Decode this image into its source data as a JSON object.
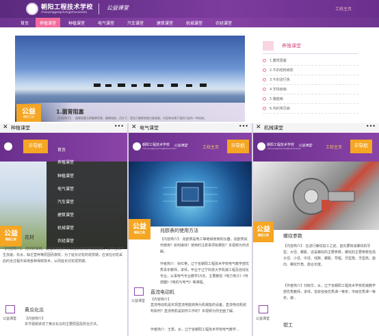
{
  "desktop": {
    "school_name": "朝阳工程技术学校",
    "school_name_en": "chaoyanggongchengjishuxuexiao",
    "charity_label": "公益课堂",
    "main_site": "工校主页",
    "nav": [
      "首页",
      "养殖课堂",
      "种植课堂",
      "电气课堂",
      "汽车课堂",
      "建筑课堂",
      "机械课堂",
      "农经课堂"
    ],
    "banner_caption": "1.菌胃阻塞",
    "banner_badge": "公益",
    "banner_badge_sub": "朝阳工校",
    "banner_text": "【内容简介】：菌胃阻塞又称瓣胃积食、瓣胃秘结、百叶干，是由于瓣胃收缩力量减弱，内容物充满干涸而引起的一种疾病。",
    "sidebar_title": "养殖课堂",
    "sidebar_items": [
      "1.菌胃阻塞",
      "2.牛的结核病防",
      "3.牛的流行热",
      "4.羊快疫病",
      "5.猪瘟病",
      "6.鸡的常见病"
    ]
  },
  "phone1": {
    "title": "种植课堂",
    "more": "•••",
    "nav_button": "导航",
    "menu": [
      "首页",
      "养殖课堂",
      "种植课堂",
      "电气课堂",
      "汽车课堂",
      "建筑课堂",
      "机械课堂",
      "农经课堂"
    ],
    "badge": "公益",
    "badge_sub": "朝阳工校",
    "heading": "花材",
    "text": "【内容简介】：花材的保鲜，是指采用各种方法延长切花的观赏期限，由于乙烯产生加速，失水，缺乏营养等原因而衰败，为了延长切花的观赏期，应该在切花采后的全过程中采用各种保鲜技术，从而延长切花观赏期。",
    "icon_label": "公益课堂",
    "item_title": "黄瓜化瓜",
    "item_tag": "【内容简介】",
    "item_text": "本节视频讲述了黄瓜化瓜的主要原因及防治方法。"
  },
  "phone2": {
    "title": "电气课堂",
    "more": "•••",
    "school_name": "朝阳工程技术学校",
    "school_name_en": "chaoyanggongchengjishuxuexiao",
    "charity_label": "公益课堂",
    "main_site": "工校主页",
    "nav_button": "导航",
    "badge": "公益",
    "badge_sub": "朝阳工校",
    "heading": "兆欧表的使用方法",
    "text1": "【内容简介】：兆欧表是电工等绝缘使用的仪器，兆欧表如何使用？如何接线？使用时注意事项有哪些？本视频为你详解。",
    "text2": "作者简介：张红艳，辽宁省朝阳工程技术学校电气教学部优秀青年教师，讲师，毕业于辽宁科技大学机械工程及自动化专业，从事电气专业教学15年。主要教授《电力电子》《传感器》《电机与电气》等课程。",
    "icon_label": "公益课堂",
    "item_title": "直流电动机",
    "item_tag": "【内容简介】",
    "item_text": "直流电动机是实现直流电能转换为机械能的设备，直流电动机结构如何？直流电机是如何工作的？本视频为你全面了解。",
    "item_author": "作者简介：王惠，女，辽宁省朝阳工程技术学校电气教学..."
  },
  "phone3": {
    "title": "机械课堂",
    "more": "•••",
    "school_name": "朝阳工程技术学校",
    "school_name_en": "chaoyanggongchengjishuxuexiao",
    "charity_label": "公益课堂",
    "main_site": "工校主页",
    "nav_button": "导航",
    "badge": "公益",
    "badge_sub": "朝阳工校",
    "heading": "螺纹参数",
    "text": "【内容简介】：在进行螺纹加工之前，首先要知道螺纹的牙型、大径、螺距、这是螺纹的主要参数，螺纹的主要参数包括大径、小径、中径、线数、螺距、导程、牙型角、牙型高、旋向、螺纹升角、旋合长度。",
    "author": "【作者简介】刘晓华，女，辽宁省朝阳工程技术学校机械教学部优秀教师，讲师，曾获省级优秀课一等奖，市级优秀课一等奖，被...",
    "icon_label": "公益课堂",
    "item_title": "钳工"
  },
  "colors": {
    "purple": "#6a2f8c",
    "pink": "#f26b9b",
    "orange": "#f5a623"
  }
}
